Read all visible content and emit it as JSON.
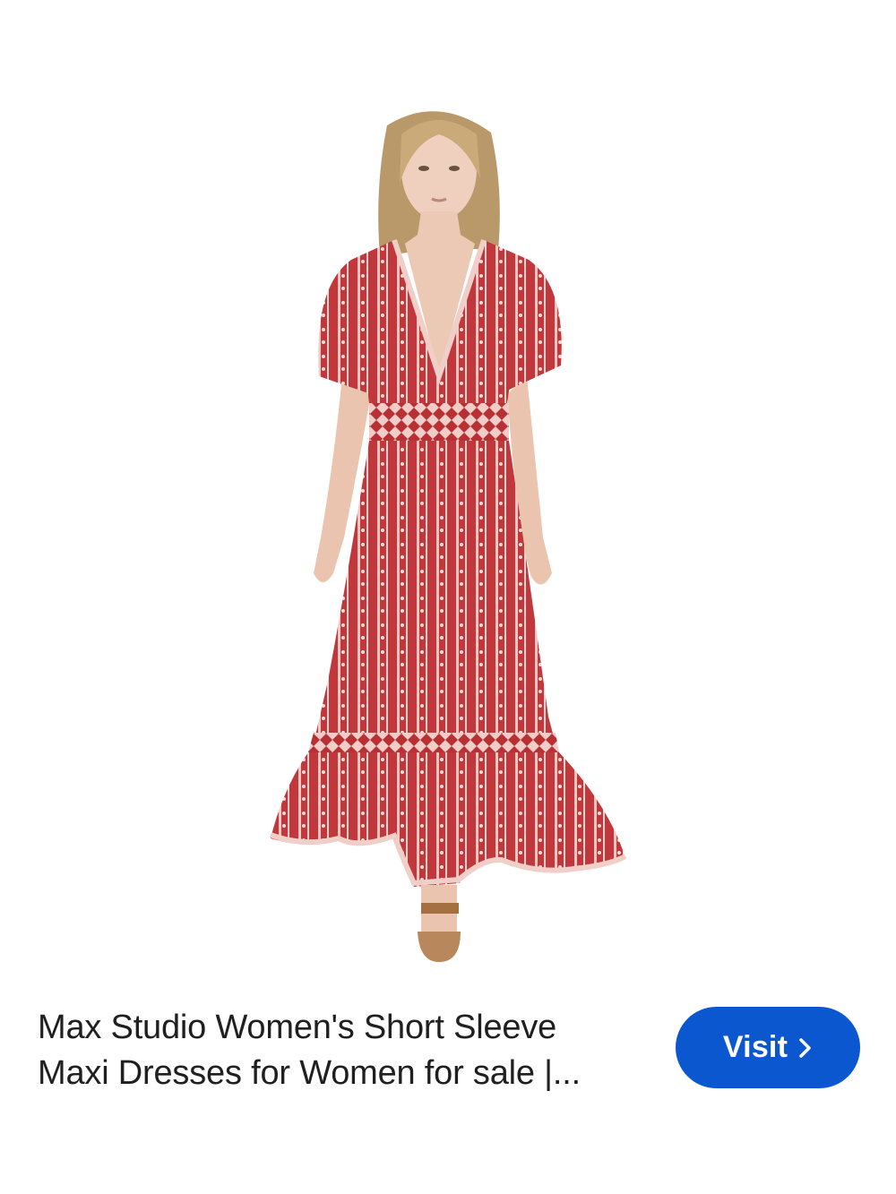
{
  "image": {
    "alt": "Woman wearing red printed short sleeve maxi dress"
  },
  "result": {
    "title_line_1": "Max Studio Women's Short Sleeve",
    "title_line_2": "Maxi Dresses for Women for sale |..."
  },
  "visit_button": {
    "label": "Visit",
    "icon": "chevron-right-icon"
  },
  "colors": {
    "accent": "#0b57d0",
    "dress": "#c2373b",
    "text": "#1f1f1f"
  }
}
